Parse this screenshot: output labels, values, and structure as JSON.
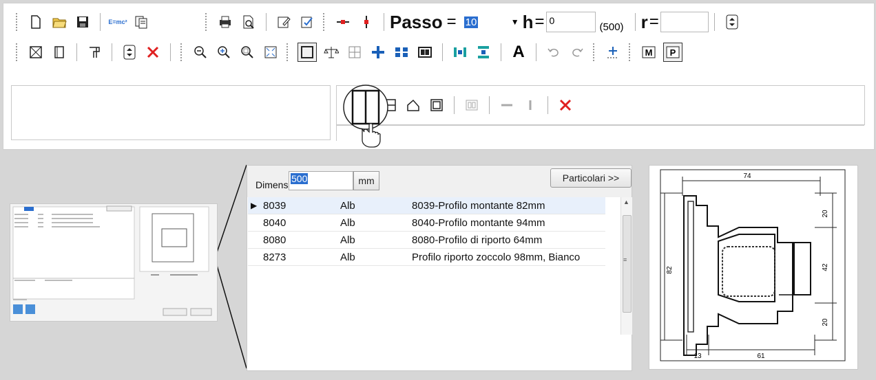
{
  "toolbar": {
    "passo_label": "Passo",
    "eq1": "=",
    "passo_value": "10",
    "h_label": "h",
    "eq2": "=",
    "h_value": "0",
    "h_hint": "(500)",
    "r_label": "r",
    "eq3": "=",
    "r_value": "",
    "formula_icon_text": "E=mc²"
  },
  "grid": {
    "dim_label": "Dimens",
    "dim_value": "500",
    "unit": "mm",
    "details_button": "Particolari >>",
    "rows": [
      {
        "code": "8039",
        "color": "Alb",
        "desc": "8039-Profilo montante 82mm"
      },
      {
        "code": "8040",
        "color": "Alb",
        "desc": "8040-Profilo montante 94mm"
      },
      {
        "code": "8080",
        "color": "Alb",
        "desc": "8080-Profilo di riporto 64mm"
      },
      {
        "code": "8273",
        "color": "Alb",
        "desc": "Profilo riporto zoccolo 98mm, Bianco"
      }
    ]
  },
  "drawing": {
    "dim_top": "74",
    "dim_right_top": "20",
    "dim_right_mid": "42",
    "dim_right_bot": "20",
    "dim_left": "82",
    "dim_bottom_left": "13",
    "dim_bottom_right": "61"
  },
  "colors": {
    "accent": "#2a6ecf",
    "red": "#e02020",
    "selected_row": "#e8f0fb"
  }
}
